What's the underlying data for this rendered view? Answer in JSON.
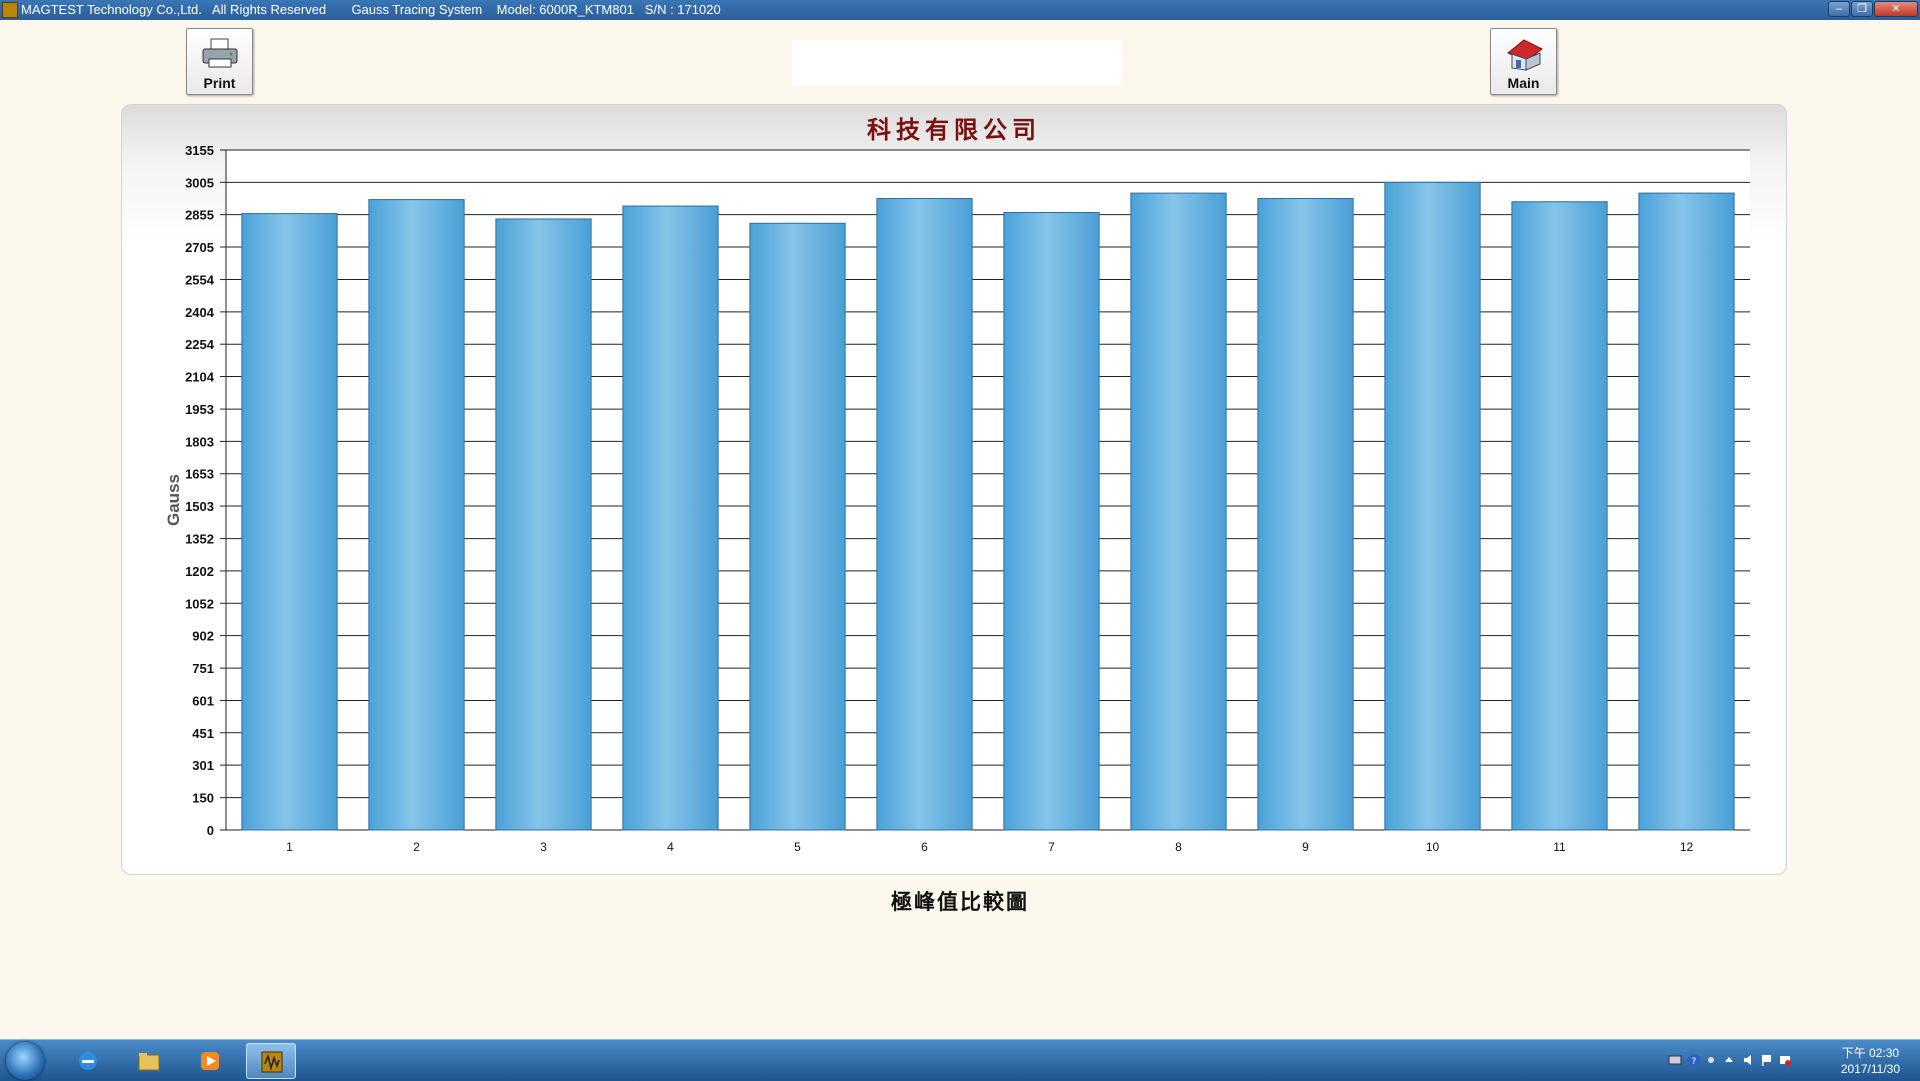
{
  "window": {
    "title": "MAGTEST Technology Co.,Ltd.   All Rights Reserved       Gauss Tracing System    Model: 6000R_KTM801   S/N : 171020"
  },
  "toolbar": {
    "print_label": "Print",
    "main_label": "Main"
  },
  "caption": "極峰值比較圖",
  "chart_data": {
    "type": "bar",
    "title": "科技有限公司",
    "xlabel": "",
    "ylabel": "Gauss",
    "categories": [
      "1",
      "2",
      "3",
      "4",
      "5",
      "6",
      "7",
      "8",
      "9",
      "10",
      "11",
      "12"
    ],
    "values": [
      2860,
      2925,
      2835,
      2895,
      2815,
      2930,
      2865,
      2955,
      2930,
      3005,
      2915,
      2955
    ],
    "y_ticks": [
      "0",
      "150",
      "301",
      "451",
      "601",
      "751",
      "902",
      "1052",
      "1202",
      "1352",
      "1503",
      "1653",
      "1803",
      "1953",
      "2104",
      "2254",
      "2404",
      "2554",
      "2705",
      "2855",
      "3005",
      "3155"
    ],
    "ylim": [
      0,
      3155
    ],
    "grid": true,
    "bar_color": "#5aaee0"
  },
  "taskbar": {
    "clock_period": "下午 02:30",
    "clock_date": "2017/11/30"
  }
}
